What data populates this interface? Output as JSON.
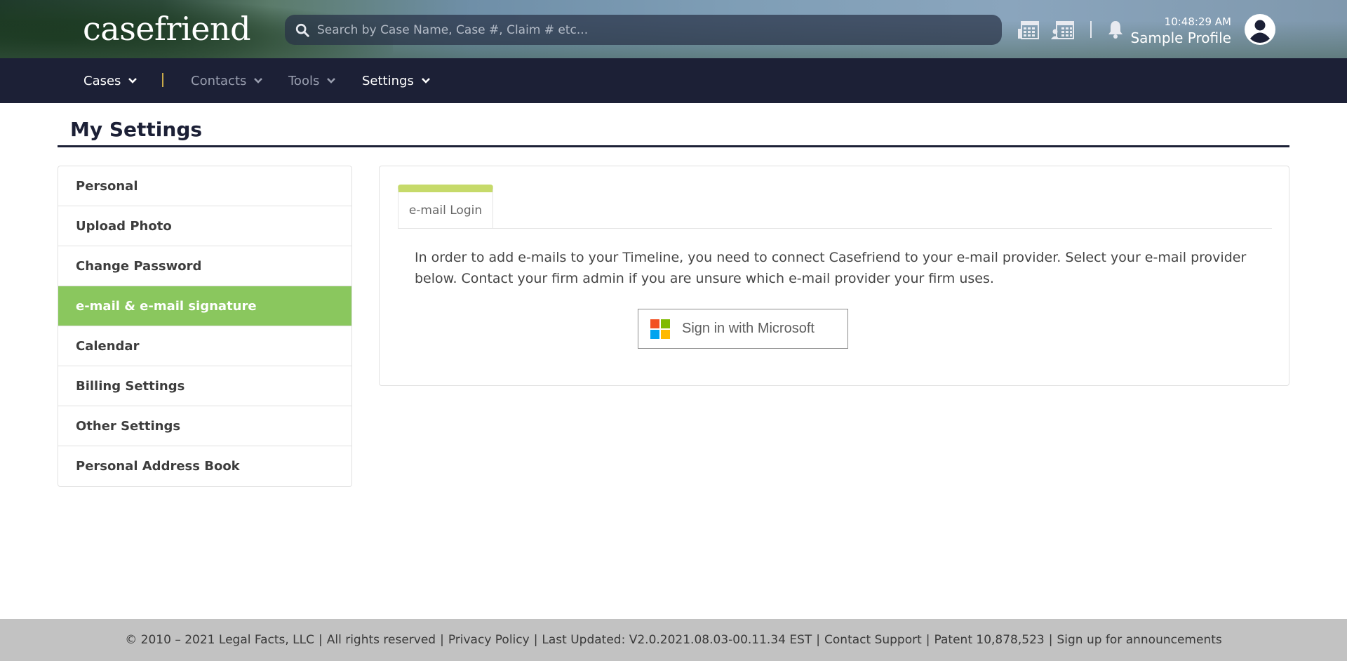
{
  "header": {
    "logo_text": "casefriend",
    "search_placeholder": "Search by Case Name, Case #, Claim # etc...",
    "clock": "10:48:29 AM",
    "profile_name": "Sample Profile",
    "icons": [
      "calendar-grid-icon",
      "user-calendar-icon",
      "bell-icon",
      "user-avatar-icon"
    ]
  },
  "nav": {
    "items": [
      {
        "label": "Cases",
        "color": "#ffffff"
      },
      {
        "label": "Contacts",
        "color": "#9a9fb0"
      },
      {
        "label": "Tools",
        "color": "#9a9fb0"
      },
      {
        "label": "Settings",
        "color": "#ffffff"
      }
    ]
  },
  "page": {
    "title": "My Settings"
  },
  "sidebar": {
    "items": [
      {
        "label": "Personal"
      },
      {
        "label": "Upload Photo"
      },
      {
        "label": "Change Password"
      },
      {
        "label": "e-mail & e-mail signature",
        "active": true
      },
      {
        "label": "Calendar"
      },
      {
        "label": "Billing Settings"
      },
      {
        "label": "Other Settings"
      },
      {
        "label": "Personal Address Book"
      }
    ]
  },
  "content": {
    "tab_label": "e-mail Login",
    "info_text": "In order to add e-mails to your Timeline, you need to connect Casefriend to your e-mail provider. Select your e-mail provider below. Contact your firm admin if you are unsure which e-mail provider your firm uses.",
    "ms_button_label": "Sign in with Microsoft",
    "ms_colors": [
      "#f25022",
      "#7fba00",
      "#00a4ef",
      "#ffb900"
    ]
  },
  "footer": {
    "copyright": "© 2010 – 2021 Legal Facts, LLC",
    "rights": "All rights reserved",
    "privacy": "Privacy Policy",
    "updated": "Last Updated: V2.0.2021.08.03-00.11.34 EST",
    "support": "Contact Support",
    "patent": "Patent 10,878,523",
    "announce": "Sign up for announcements"
  },
  "colors": {
    "navbar": "#1c2036",
    "active": "#8ac75e",
    "tab_accent": "#c6da6a"
  }
}
